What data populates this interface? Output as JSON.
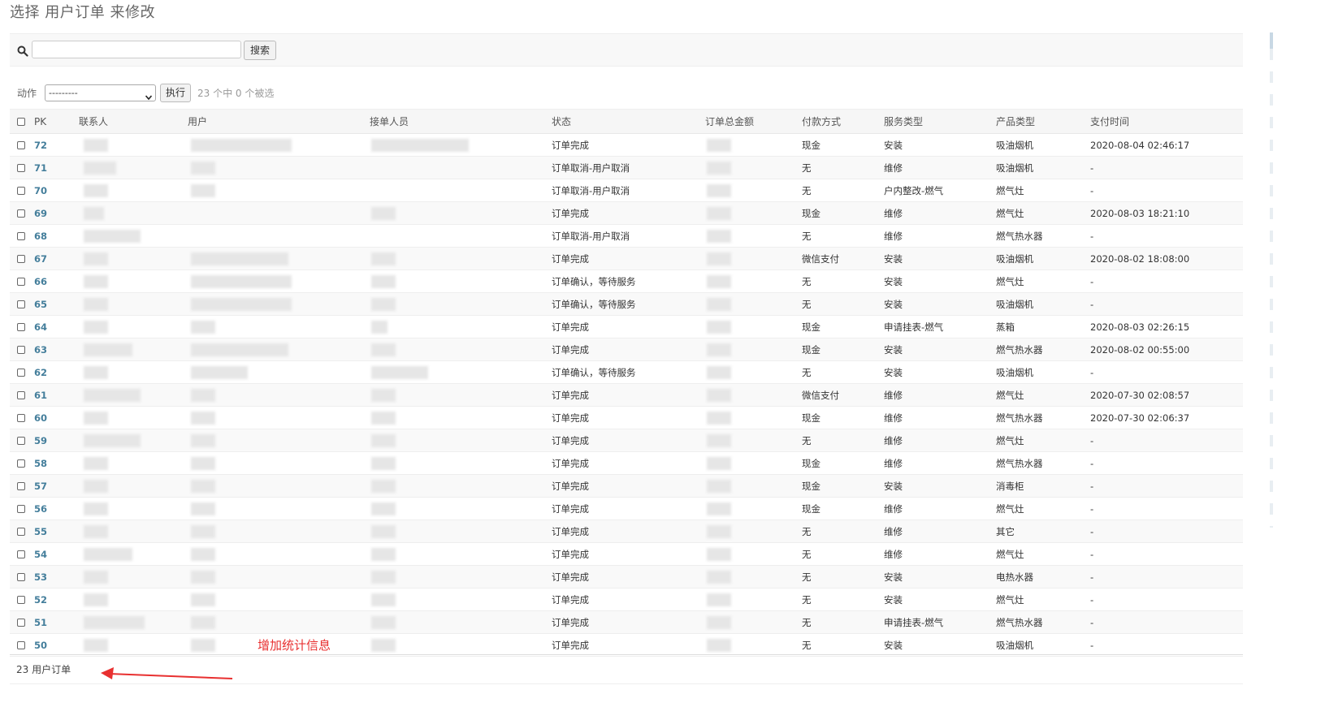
{
  "page": {
    "title": "选择 用户订单 来修改"
  },
  "search": {
    "icon": "search-icon",
    "value": "",
    "button_label": "搜索"
  },
  "actions": {
    "label": "动作",
    "selected": "---------",
    "run_label": "执行",
    "counter": "23 个中 0 个被选"
  },
  "table": {
    "columns": [
      "PK",
      "联系人",
      "用户",
      "接单人员",
      "状态",
      "订单总金额",
      "付款方式",
      "服务类型",
      "产品类型",
      "支付时间"
    ],
    "rows": [
      {
        "pk": "72",
        "status": "订单完成",
        "payment": "现金",
        "service": "安装",
        "product": "吸油烟机",
        "paid_at": "2020-08-04 02:46:17"
      },
      {
        "pk": "71",
        "status": "订单取消-用户取消",
        "payment": "无",
        "service": "维修",
        "product": "吸油烟机",
        "paid_at": "-"
      },
      {
        "pk": "70",
        "status": "订单取消-用户取消",
        "payment": "无",
        "service": "户内整改-燃气",
        "product": "燃气灶",
        "paid_at": "-"
      },
      {
        "pk": "69",
        "status": "订单完成",
        "payment": "现金",
        "service": "维修",
        "product": "燃气灶",
        "paid_at": "2020-08-03 18:21:10"
      },
      {
        "pk": "68",
        "status": "订单取消-用户取消",
        "payment": "无",
        "service": "维修",
        "product": "燃气热水器",
        "paid_at": "-"
      },
      {
        "pk": "67",
        "status": "订单完成",
        "payment": "微信支付",
        "service": "安装",
        "product": "吸油烟机",
        "paid_at": "2020-08-02 18:08:00"
      },
      {
        "pk": "66",
        "status": "订单确认，等待服务",
        "payment": "无",
        "service": "安装",
        "product": "燃气灶",
        "paid_at": "-"
      },
      {
        "pk": "65",
        "status": "订单确认，等待服务",
        "payment": "无",
        "service": "安装",
        "product": "吸油烟机",
        "paid_at": "-"
      },
      {
        "pk": "64",
        "status": "订单完成",
        "payment": "现金",
        "service": "申请挂表-燃气",
        "product": "蒸箱",
        "paid_at": "2020-08-03 02:26:15"
      },
      {
        "pk": "63",
        "status": "订单完成",
        "payment": "现金",
        "service": "安装",
        "product": "燃气热水器",
        "paid_at": "2020-08-02 00:55:00"
      },
      {
        "pk": "62",
        "status": "订单确认，等待服务",
        "payment": "无",
        "service": "安装",
        "product": "吸油烟机",
        "paid_at": "-"
      },
      {
        "pk": "61",
        "status": "订单完成",
        "payment": "微信支付",
        "service": "维修",
        "product": "燃气灶",
        "paid_at": "2020-07-30 02:08:57"
      },
      {
        "pk": "60",
        "status": "订单完成",
        "payment": "现金",
        "service": "维修",
        "product": "燃气热水器",
        "paid_at": "2020-07-30 02:06:37"
      },
      {
        "pk": "59",
        "status": "订单完成",
        "payment": "无",
        "service": "维修",
        "product": "燃气灶",
        "paid_at": "-"
      },
      {
        "pk": "58",
        "status": "订单完成",
        "payment": "现金",
        "service": "维修",
        "product": "燃气热水器",
        "paid_at": "-"
      },
      {
        "pk": "57",
        "status": "订单完成",
        "payment": "现金",
        "service": "安装",
        "product": "消毒柜",
        "paid_at": "-"
      },
      {
        "pk": "56",
        "status": "订单完成",
        "payment": "现金",
        "service": "维修",
        "product": "燃气灶",
        "paid_at": "-"
      },
      {
        "pk": "55",
        "status": "订单完成",
        "payment": "无",
        "service": "维修",
        "product": "其它",
        "paid_at": "-"
      },
      {
        "pk": "54",
        "status": "订单完成",
        "payment": "无",
        "service": "维修",
        "product": "燃气灶",
        "paid_at": "-"
      },
      {
        "pk": "53",
        "status": "订单完成",
        "payment": "无",
        "service": "安装",
        "product": "电热水器",
        "paid_at": "-"
      },
      {
        "pk": "52",
        "status": "订单完成",
        "payment": "无",
        "service": "安装",
        "product": "燃气灶",
        "paid_at": "-"
      },
      {
        "pk": "51",
        "status": "订单完成",
        "payment": "无",
        "service": "申请挂表-燃气",
        "product": "燃气热水器",
        "paid_at": "-"
      },
      {
        "pk": "50",
        "status": "订单完成",
        "payment": "无",
        "service": "安装",
        "product": "吸油烟机",
        "paid_at": "-"
      }
    ]
  },
  "footer": {
    "count": "23 用户订单"
  },
  "annotation": {
    "text": "增加统计信息",
    "color": "#e83030",
    "icon": "arrow-left-icon"
  }
}
